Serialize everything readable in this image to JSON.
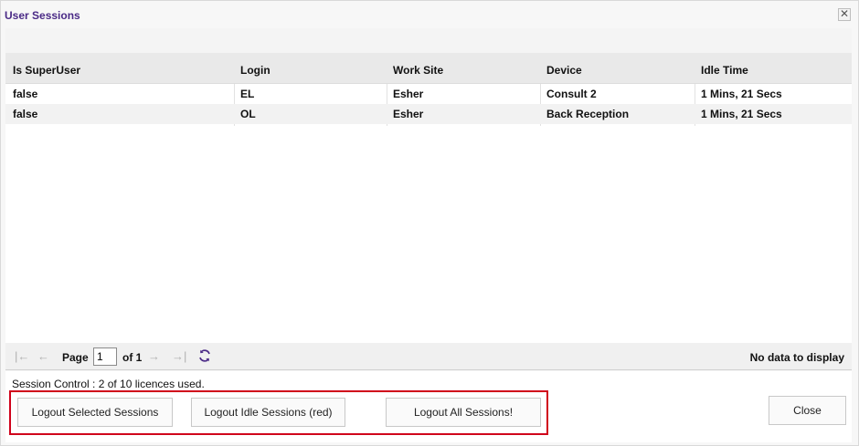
{
  "dialog": {
    "title": "User Sessions",
    "close_glyph": "✕"
  },
  "grid": {
    "columns": [
      "Is SuperUser",
      "Login",
      "Work Site",
      "Device",
      "Idle Time"
    ],
    "rows": [
      [
        "false",
        "EL",
        "Esher",
        "Consult 2",
        "1 Mins, 21 Secs"
      ],
      [
        "false",
        "OL",
        "Esher",
        "Back Reception",
        "1 Mins, 21 Secs"
      ]
    ]
  },
  "pager": {
    "first_glyph": "|←",
    "prev_glyph": "←",
    "page_label": "Page",
    "page_value": "1",
    "of_label": "of 1",
    "next_glyph": "→",
    "last_glyph": "→|",
    "refresh_icon": "refresh-icon",
    "status": "No data to display"
  },
  "footer": {
    "session_text": "Session Control : 2 of 10 licences used.",
    "logout_selected": "Logout Selected Sessions",
    "logout_idle": "Logout Idle Sessions (red)",
    "logout_all": "Logout All Sessions!",
    "close": "Close"
  },
  "colors": {
    "title": "#4a2a86",
    "highlight_border": "#d0021b",
    "refresh": "#4a2a86"
  }
}
